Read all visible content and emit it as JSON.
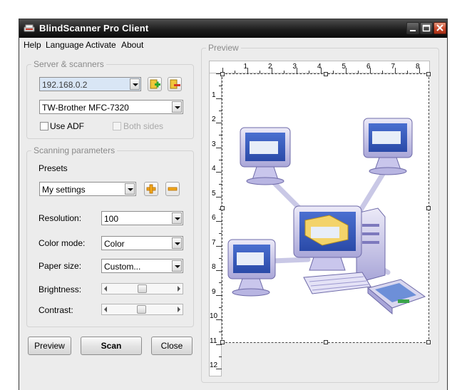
{
  "window": {
    "title": "BlindScanner Pro Client"
  },
  "menu": [
    "Help",
    "Language",
    "Activate",
    "About"
  ],
  "server_group": {
    "title": "Server & scanners",
    "server_value": "192.168.0.2",
    "scanner_value": "TW-Brother MFC-7320",
    "use_adf_label": "Use ADF",
    "both_sides_label": "Both sides"
  },
  "scan_group": {
    "title": "Scanning parameters",
    "presets_label": "Presets",
    "preset_value": "My settings",
    "resolution_label": "Resolution:",
    "resolution_value": "100",
    "color_mode_label": "Color mode:",
    "color_mode_value": "Color",
    "paper_size_label": "Paper size:",
    "paper_size_value": "Custom...",
    "brightness_label": "Brightness:",
    "brightness_level": 0.5,
    "contrast_label": "Contrast:",
    "contrast_level": 0.49
  },
  "buttons": {
    "preview": "Preview",
    "scan": "Scan",
    "close": "Close"
  },
  "preview": {
    "title": "Preview",
    "ruler_top": [
      "1",
      "2",
      "3",
      "4",
      "5",
      "6",
      "7",
      "8"
    ],
    "ruler_left": [
      "1",
      "2",
      "3",
      "4",
      "5",
      "6",
      "7",
      "8",
      "9",
      "10",
      "11",
      "12"
    ]
  }
}
